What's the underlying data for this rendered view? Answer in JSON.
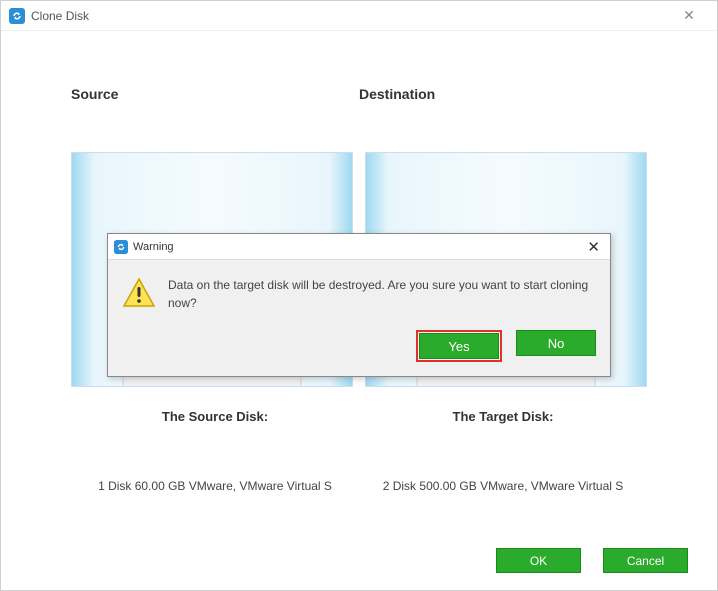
{
  "window": {
    "title": "Clone Disk"
  },
  "headers": {
    "source": "Source",
    "destination": "Destination"
  },
  "labels": {
    "source": "The Source Disk:",
    "target": "The Target Disk:"
  },
  "details": {
    "source": "1 Disk 60.00 GB VMware,  VMware Virtual S",
    "target": "2 Disk 500.00 GB VMware,  VMware Virtual S"
  },
  "footer": {
    "ok": "OK",
    "cancel": "Cancel"
  },
  "modal": {
    "title": "Warning",
    "message": "Data on the target disk will be destroyed. Are you sure you want to start cloning now?",
    "yes": "Yes",
    "no": "No"
  }
}
